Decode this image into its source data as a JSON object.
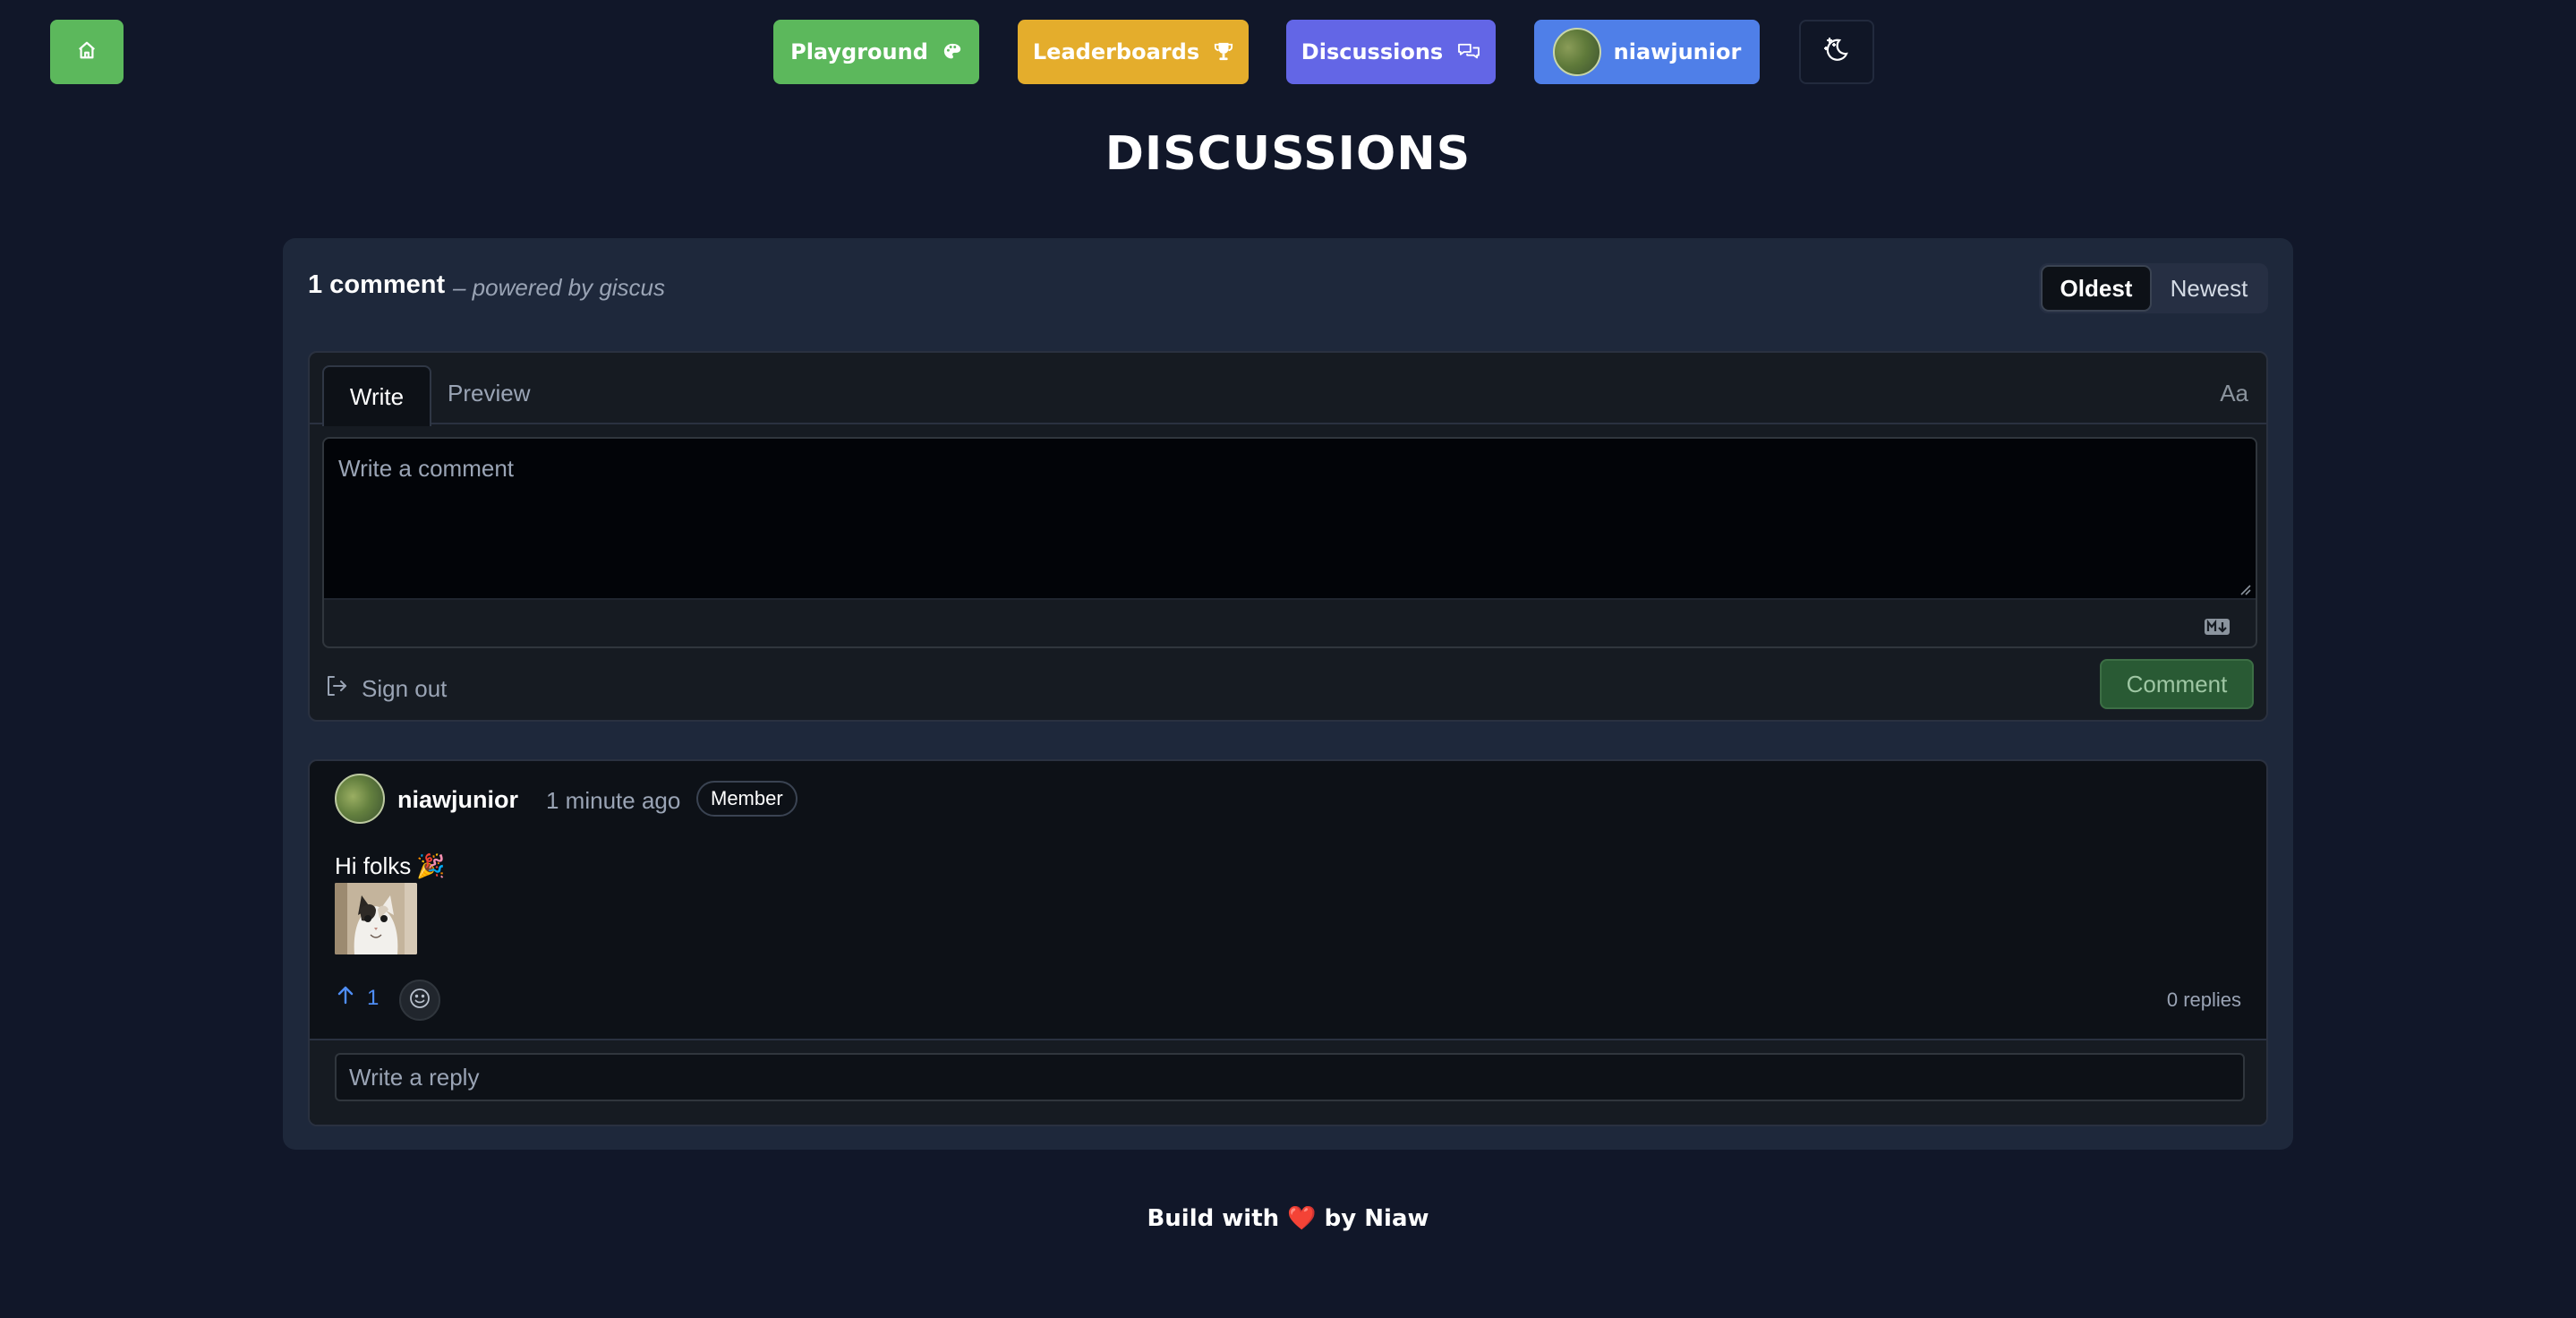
{
  "nav": {
    "home_icon": "home-icon",
    "playground_label": "Playground",
    "playground_icon": "palette-icon",
    "leaderboards_label": "Leaderboards",
    "leaderboards_icon": "trophy-icon",
    "discussions_label": "Discussions",
    "discussions_icon": "chat-bubbles-icon",
    "user_label": "niawjunior",
    "theme_icon": "moon-stars-icon",
    "colors": {
      "home": "#5cb85c",
      "playground": "#5cb85c",
      "leaderboards": "#e4ad2c",
      "discussions": "#6366e6",
      "user": "#4f7fe8"
    }
  },
  "page": {
    "title": "DISCUSSIONS",
    "background": "#111729"
  },
  "giscus": {
    "comment_count": "1 comment",
    "powered_by": "– powered by giscus",
    "sort": {
      "options": [
        "Oldest",
        "Newest"
      ],
      "selected": "Oldest"
    },
    "editor": {
      "tab_write": "Write",
      "tab_preview": "Preview",
      "text_size_label": "Aa",
      "placeholder": "Write a comment",
      "value": "",
      "markdown_icon": "markdown-icon",
      "sign_out_label": "Sign out",
      "submit_label": "Comment"
    },
    "comments": [
      {
        "author": "niawjunior",
        "time": "1 minute ago",
        "badge": "Member",
        "text": "Hi folks",
        "emoji": "🎉",
        "image": "cat-photo",
        "upvotes": "1",
        "replies": "0 replies",
        "reply_placeholder": "Write a reply"
      }
    ]
  },
  "footer": {
    "text_before": "Build with",
    "heart": "❤️",
    "text_after": "by Niaw"
  }
}
